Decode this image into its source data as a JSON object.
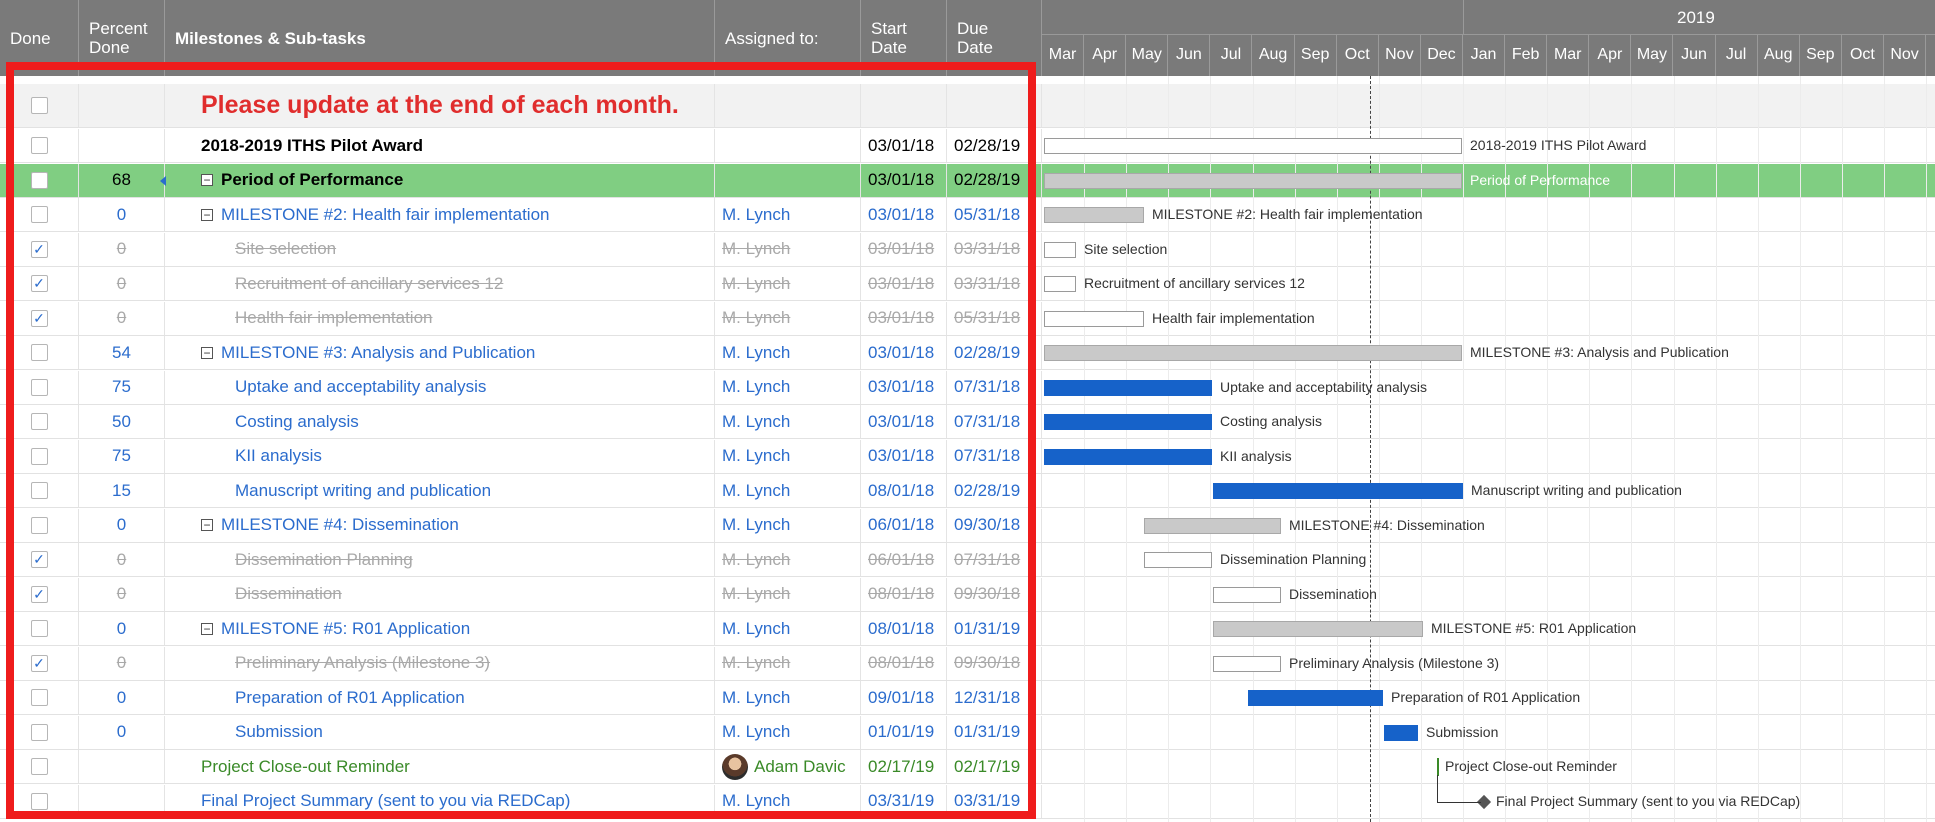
{
  "header": {
    "done": "Done",
    "percent_done": "Percent Done",
    "task": "Milestones & Sub-tasks",
    "assigned": "Assigned to:",
    "start": "Start Date",
    "due": "Due Date"
  },
  "gantt_header": {
    "year": "2019",
    "months": [
      "Mar",
      "Apr",
      "May",
      "Jun",
      "Jul",
      "Aug",
      "Sep",
      "Oct",
      "Nov",
      "Dec",
      "Jan",
      "Feb",
      "Mar",
      "Apr",
      "May",
      "Jun",
      "Jul",
      "Aug",
      "Sep",
      "Oct",
      "Nov"
    ]
  },
  "notice": "Please update at the end of each month.",
  "rows": [
    {
      "task": "2018-2019 ITHS Pilot Award",
      "start": "03/01/18",
      "due": "02/28/19",
      "gantt_label": "2018-2019 ITHS Pilot Award"
    },
    {
      "pct": "68",
      "task": "Period of Performance",
      "start": "03/01/18",
      "due": "02/28/19",
      "gantt_label": "Period of Performance"
    },
    {
      "pct": "0",
      "task": "MILESTONE #2: Health fair implementation",
      "assigned": "M. Lynch",
      "start": "03/01/18",
      "due": "05/31/18",
      "gantt_label": "MILESTONE #2: Health fair implementation"
    },
    {
      "pct": "0",
      "task": "Site selection",
      "assigned": "M. Lynch",
      "start": "03/01/18",
      "due": "03/31/18",
      "gantt_label": "Site selection"
    },
    {
      "pct": "0",
      "task": "Recruitment of ancillary services 12",
      "assigned": "M. Lynch",
      "start": "03/01/18",
      "due": "03/31/18",
      "gantt_label": "Recruitment of ancillary services 12"
    },
    {
      "pct": "0",
      "task": "Health fair implementation",
      "assigned": "M. Lynch",
      "start": "03/01/18",
      "due": "05/31/18",
      "gantt_label": "Health fair implementation"
    },
    {
      "pct": "54",
      "task": "MILESTONE #3: Analysis and Publication",
      "assigned": "M. Lynch",
      "start": "03/01/18",
      "due": "02/28/19",
      "gantt_label": "MILESTONE #3: Analysis and Publication"
    },
    {
      "pct": "75",
      "task": "Uptake and acceptability analysis",
      "assigned": "M. Lynch",
      "start": "03/01/18",
      "due": "07/31/18",
      "gantt_label": "Uptake and acceptability analysis"
    },
    {
      "pct": "50",
      "task": "Costing analysis",
      "assigned": "M. Lynch",
      "start": "03/01/18",
      "due": "07/31/18",
      "gantt_label": "Costing analysis"
    },
    {
      "pct": "75",
      "task": "KII analysis",
      "assigned": "M. Lynch",
      "start": "03/01/18",
      "due": "07/31/18",
      "gantt_label": "KII analysis"
    },
    {
      "pct": "15",
      "task": "Manuscript writing and publication",
      "assigned": "M. Lynch",
      "start": "08/01/18",
      "due": "02/28/19",
      "gantt_label": "Manuscript writing and publication"
    },
    {
      "pct": "0",
      "task": "MILESTONE #4: Dissemination",
      "assigned": "M. Lynch",
      "start": "06/01/18",
      "due": "09/30/18",
      "gantt_label": "MILESTONE #4: Dissemination"
    },
    {
      "pct": "0",
      "task": "Dissemination Planning",
      "assigned": "M. Lynch",
      "start": "06/01/18",
      "due": "07/31/18",
      "gantt_label": "Dissemination Planning"
    },
    {
      "pct": "0",
      "task": "Dissemination",
      "assigned": "M. Lynch",
      "start": "08/01/18",
      "due": "09/30/18",
      "gantt_label": "Dissemination"
    },
    {
      "pct": "0",
      "task": "MILESTONE #5: R01 Application",
      "assigned": "M. Lynch",
      "start": "08/01/18",
      "due": "01/31/19",
      "gantt_label": "MILESTONE #5: R01 Application"
    },
    {
      "pct": "0",
      "task": "Preliminary Analysis (Milestone 3)",
      "assigned": "M. Lynch",
      "start": "08/01/18",
      "due": "09/30/18",
      "gantt_label": "Preliminary Analysis (Milestone 3)"
    },
    {
      "pct": "0",
      "task": "Preparation of R01 Application",
      "assigned": "M. Lynch",
      "start": "09/01/18",
      "due": "12/31/18",
      "gantt_label": "Preparation of R01 Application"
    },
    {
      "pct": "0",
      "task": "Submission",
      "assigned": "M. Lynch",
      "start": "01/01/19",
      "due": "01/31/19",
      "gantt_label": "Submission"
    },
    {
      "task": "Project Close-out Reminder",
      "assigned": "Adam Davic",
      "start": "02/17/19",
      "due": "02/17/19",
      "gantt_label": "Project Close-out Reminder"
    },
    {
      "task": "Final Project Summary (sent to you via REDCap)",
      "assigned": "M. Lynch",
      "start": "03/31/19",
      "due": "03/31/19",
      "gantt_label": "Final Project Summary (sent to you via REDCap)"
    }
  ],
  "colors": {
    "header_bg": "#7a7a7a",
    "period_row": "#80ce82",
    "link_blue": "#2b6ccd",
    "gantt_bar_blue": "#1662c9",
    "notice_red": "#e02d2d",
    "frame_red": "#ef1c1c"
  }
}
